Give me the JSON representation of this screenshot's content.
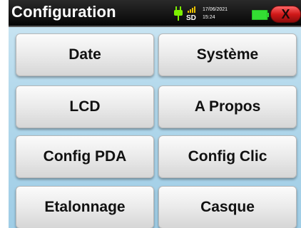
{
  "header": {
    "title": "Configuration",
    "sd_label": "SD",
    "date": "17/06/2021",
    "time": "15:24",
    "close_symbol": "X",
    "icons": [
      "plug-icon",
      "signal-icon",
      "battery-icon",
      "close-icon"
    ],
    "colors": {
      "plug": "#7cf000",
      "battery": "#33dd33",
      "close": "#d01818"
    }
  },
  "menu": {
    "date_label": "Date",
    "systeme_label": "Système",
    "lcd_label": "LCD",
    "apropos_label": "A Propos",
    "config_pda_label": "Config PDA",
    "config_clic_label": "Config Clic",
    "etalonnage_label": "Etalonnage",
    "casque_label": "Casque"
  }
}
